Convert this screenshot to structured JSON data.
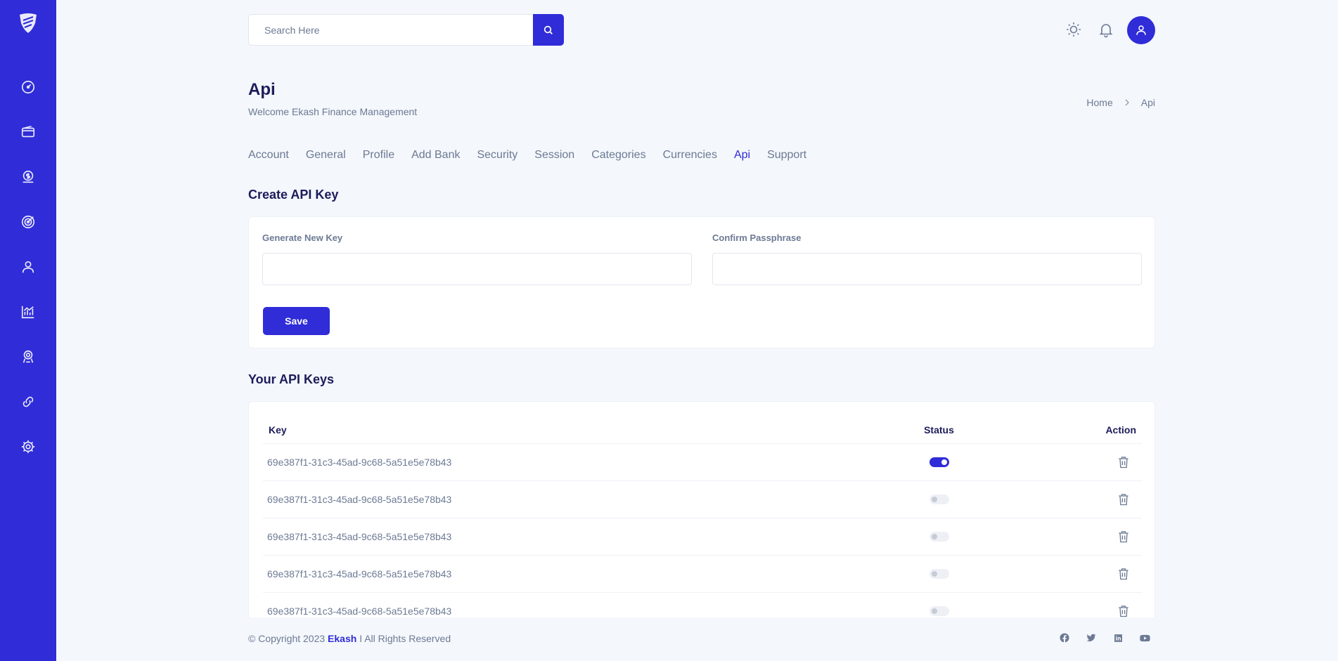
{
  "search": {
    "placeholder": "Search Here"
  },
  "header": {
    "title": "Api",
    "subtitle": "Welcome Ekash Finance Management"
  },
  "breadcrumb": {
    "home": "Home",
    "current": "Api"
  },
  "tabs": [
    "Account",
    "General",
    "Profile",
    "Add Bank",
    "Security",
    "Session",
    "Categories",
    "Currencies",
    "Api",
    "Support"
  ],
  "active_tab": "Api",
  "create_section": {
    "title": "Create API Key",
    "generate_label": "Generate New Key",
    "confirm_label": "Confirm Passphrase",
    "generate_value": "",
    "confirm_value": "",
    "save_label": "Save"
  },
  "keys_section": {
    "title": "Your API Keys",
    "columns": {
      "key": "Key",
      "status": "Status",
      "action": "Action"
    },
    "rows": [
      {
        "key": "69e387f1-31c3-45ad-9c68-5a51e5e78b43",
        "status": "on"
      },
      {
        "key": "69e387f1-31c3-45ad-9c68-5a51e5e78b43",
        "status": "off"
      },
      {
        "key": "69e387f1-31c3-45ad-9c68-5a51e5e78b43",
        "status": "off"
      },
      {
        "key": "69e387f1-31c3-45ad-9c68-5a51e5e78b43",
        "status": "off"
      },
      {
        "key": "69e387f1-31c3-45ad-9c68-5a51e5e78b43",
        "status": "off"
      }
    ]
  },
  "footer": {
    "copyright": "© Copyright 2023",
    "brand": "Ekash",
    "rights": "I All Rights Reserved",
    "social": [
      "facebook-icon",
      "twitter-icon",
      "linkedin-icon",
      "youtube-icon"
    ]
  },
  "sidebar": {
    "items": [
      "dashboard-icon",
      "wallet-icon",
      "budget-icon",
      "goals-icon",
      "profile-icon",
      "analytics-icon",
      "support-icon",
      "affiliates-icon",
      "settings-icon"
    ]
  },
  "colors": {
    "primary": "#2f2cd8",
    "background": "#f4f7fb",
    "text": "#1c1c5b",
    "muted": "#6c7a94"
  }
}
